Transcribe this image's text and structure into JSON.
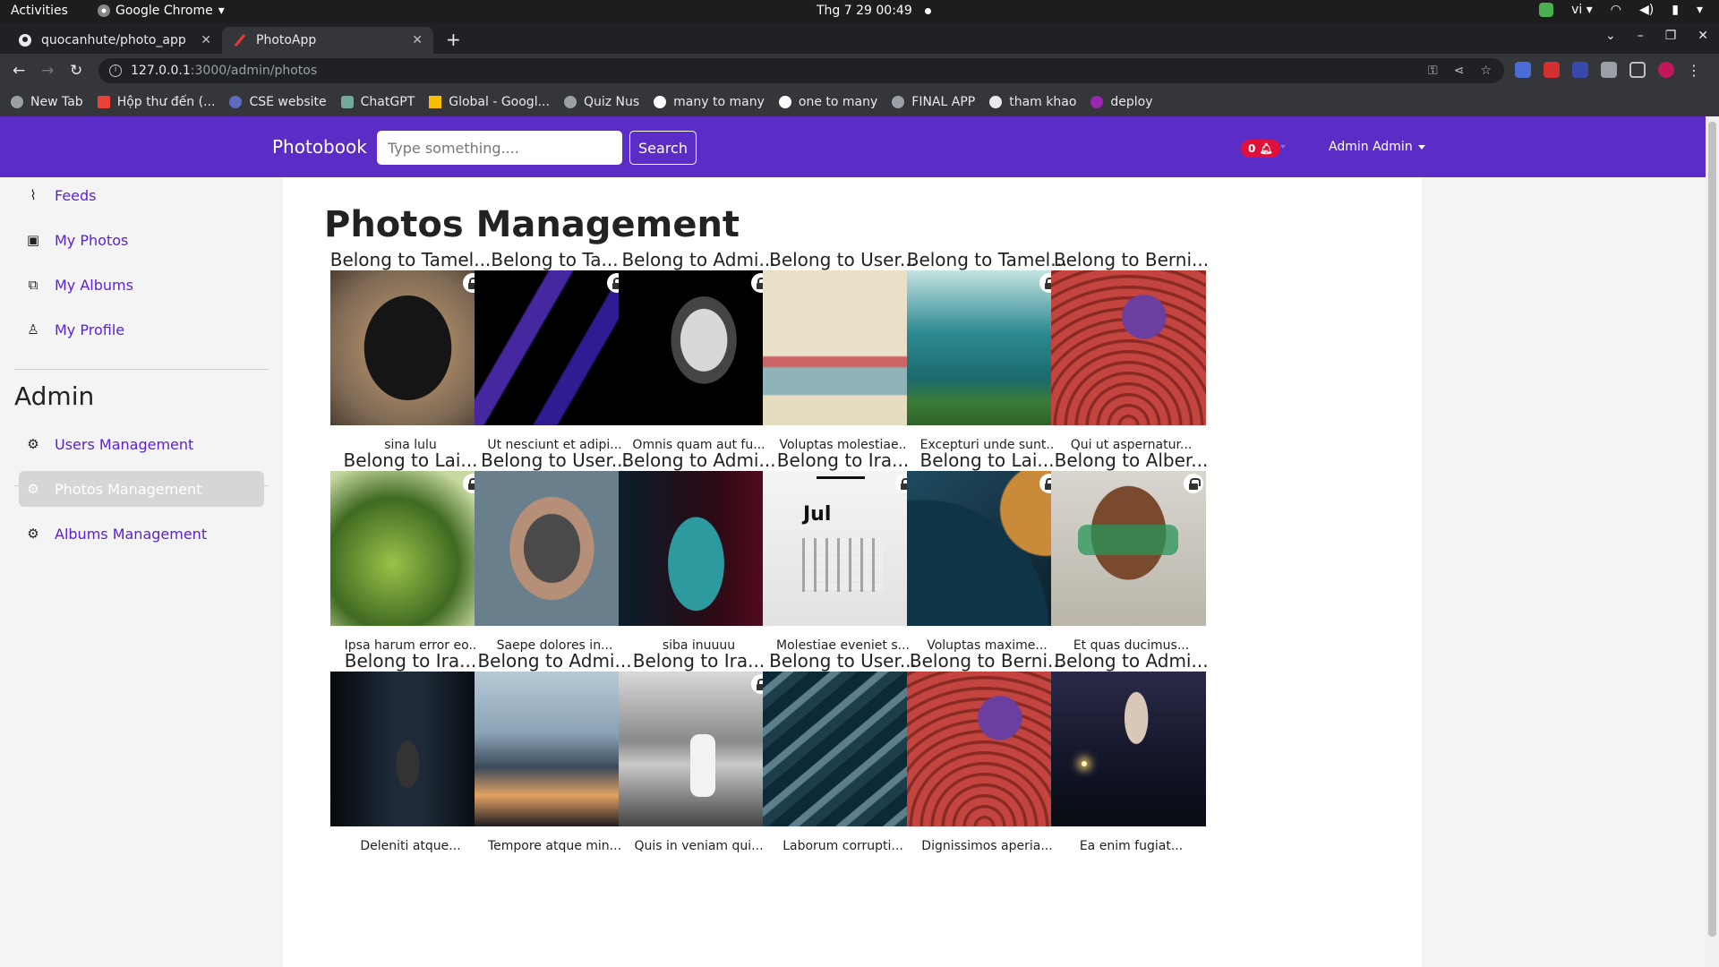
{
  "system_bar": {
    "activities": "Activities",
    "app_name": "Google Chrome",
    "clock": "Thg 7 29  00:49",
    "language": "vi"
  },
  "browser": {
    "tabs": [
      {
        "title": "quocanhute/photo_app",
        "active": false
      },
      {
        "title": "PhotoApp",
        "active": true
      }
    ],
    "url_host": "127.0.0.1",
    "url_rest": ":3000/admin/photos",
    "bookmarks": [
      "New Tab",
      "Hộp thư đến (...",
      "CSE website",
      "ChatGPT",
      "Global - Googl...",
      "Quiz Nus",
      "many to many",
      "one to many",
      "FINAL APP",
      "tham khao",
      "deploy"
    ]
  },
  "navbar": {
    "brand": "Photobook",
    "search_placeholder": "Type something....",
    "search_button": "Search",
    "notification_count": "0",
    "user_name": "Admin Admin",
    "bg_color": "#5b2dc6"
  },
  "sidebar": {
    "items": [
      {
        "label": "Feeds",
        "icon": "rss-icon"
      },
      {
        "label": "My Photos",
        "icon": "image-icon"
      },
      {
        "label": "My Albums",
        "icon": "images-icon"
      },
      {
        "label": "My Profile",
        "icon": "user-icon"
      }
    ],
    "admin_title": "Admin",
    "admin_items": [
      {
        "label": "Users Management",
        "icon": "gear-icon",
        "active": false
      },
      {
        "label": "Photos Management",
        "icon": "gear-icon",
        "active": true
      },
      {
        "label": "Albums Management",
        "icon": "gear-icon",
        "active": false
      }
    ]
  },
  "main": {
    "title": "Photos Management",
    "photos": [
      {
        "owner": "Belong to Tamel...",
        "caption": "sina lulu",
        "locked": true,
        "image": "black-dog"
      },
      {
        "owner": "Belong to Ta...",
        "caption": "Ut nesciunt et adipi...",
        "locked": true,
        "image": "purple-abstract"
      },
      {
        "owner": "Belong to Admi...",
        "caption": "Omnis quam aut fu...",
        "locked": true,
        "image": "anime-girl"
      },
      {
        "owner": "Belong to User...",
        "caption": "Voluptas molestiae..",
        "locked": false,
        "image": "maple-print"
      },
      {
        "owner": "Belong to Tamel...",
        "caption": "Excepturi unde sunt..",
        "locked": true,
        "image": "diver"
      },
      {
        "owner": "Belong to Berni...",
        "caption": "Qui ut aspernatur...",
        "locked": false,
        "image": "incense"
      },
      {
        "owner": "Belong to Lai...",
        "caption": "Ipsa harum error eo..",
        "locked": true,
        "image": "plant"
      },
      {
        "owner": "Belong to User...",
        "caption": "Saepe dolores in...",
        "locked": false,
        "image": "glitter-hands"
      },
      {
        "owner": "Belong to Admi...",
        "caption": "siba inuuuu",
        "locked": false,
        "image": "woman-neon"
      },
      {
        "owner": "Belong to Ira...",
        "caption": "Molestiae eveniet s...",
        "locked": true,
        "image": "calendar",
        "calendar_month": "Jul"
      },
      {
        "owner": "Belong to Lai...",
        "caption": "Voluptas maxime...",
        "locked": true,
        "image": "abstract-arch"
      },
      {
        "owner": "Belong to Alber...",
        "caption": "Et quas ducimus...",
        "locked": true,
        "image": "green-glasses"
      },
      {
        "owner": "Belong to Ira...",
        "caption": "Deleniti atque...",
        "locked": false,
        "image": "hallway"
      },
      {
        "owner": "Belong to Admi...",
        "caption": "Tempore atque min...",
        "locked": false,
        "image": "sunset-clouds"
      },
      {
        "owner": "Belong to Ira...",
        "caption": "Quis in veniam qui...",
        "locked": true,
        "image": "bw-field"
      },
      {
        "owner": "Belong to User...",
        "caption": "Laborum corrupti...",
        "locked": false,
        "image": "waves"
      },
      {
        "owner": "Belong to Berni...",
        "caption": "Dignissimos aperia...",
        "locked": false,
        "image": "incense"
      },
      {
        "owner": "Belong to Admi...",
        "caption": "Ea enim fugiat...",
        "locked": false,
        "image": "milky-way"
      }
    ]
  }
}
